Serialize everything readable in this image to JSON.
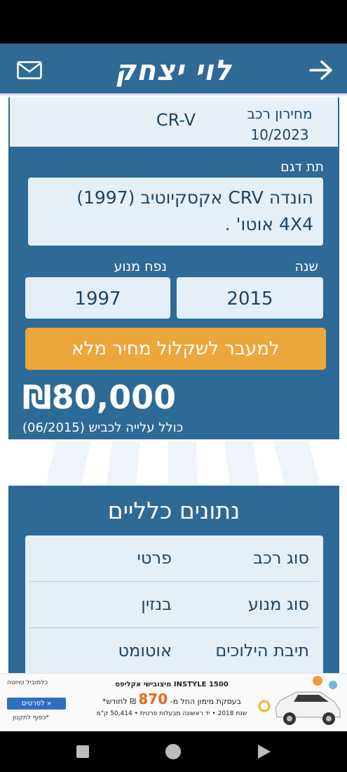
{
  "header": {
    "title": "לוי יצחק",
    "mail_icon": "mail-icon",
    "back_icon": "arrow-right-icon"
  },
  "card": {
    "pricelist_label": "מחירון רכב",
    "pricelist_date": "10/2023",
    "model": "CR-V",
    "submodel_label": "תת דגם",
    "submodel_value": "הונדה CRV אקסקיוטיב (1997) 4X4 אוטו' .",
    "year_label": "שנה",
    "engine_label": "נפח מנוע",
    "year_value": "2015",
    "engine_value": "1997",
    "cta_label": "למעבר לשקלול מחיר מלא",
    "price": "₪80,000",
    "price_note": "כולל עלייה לכביש (06/2015)"
  },
  "general": {
    "title": "נתונים כלליים",
    "rows": [
      {
        "key": "סוג רכב",
        "value": "פרטי"
      },
      {
        "key": "סוג מנוע",
        "value": "בנזין"
      },
      {
        "key": "תיבת הילוכים",
        "value": "אוטומט"
      }
    ]
  },
  "ad": {
    "headline": "מיצובישי אקליפס INSTYLE 1500",
    "offer_prefix": "בעסקת מימון החל מ-",
    "offer_amount": "870",
    "offer_suffix": "₪ לחודש*",
    "details": "שנת 2018 • יד ראשונה מבעלות פרטית • 50,414 ק\"מ",
    "button": "לפרטים »",
    "footnote": "*כפוף לתקנון",
    "brands": "כלמוביל טויוטה"
  },
  "colors": {
    "primary": "#2e6a96",
    "accent": "#eca73c",
    "box": "#e4eff8",
    "text": "#1e4462"
  }
}
